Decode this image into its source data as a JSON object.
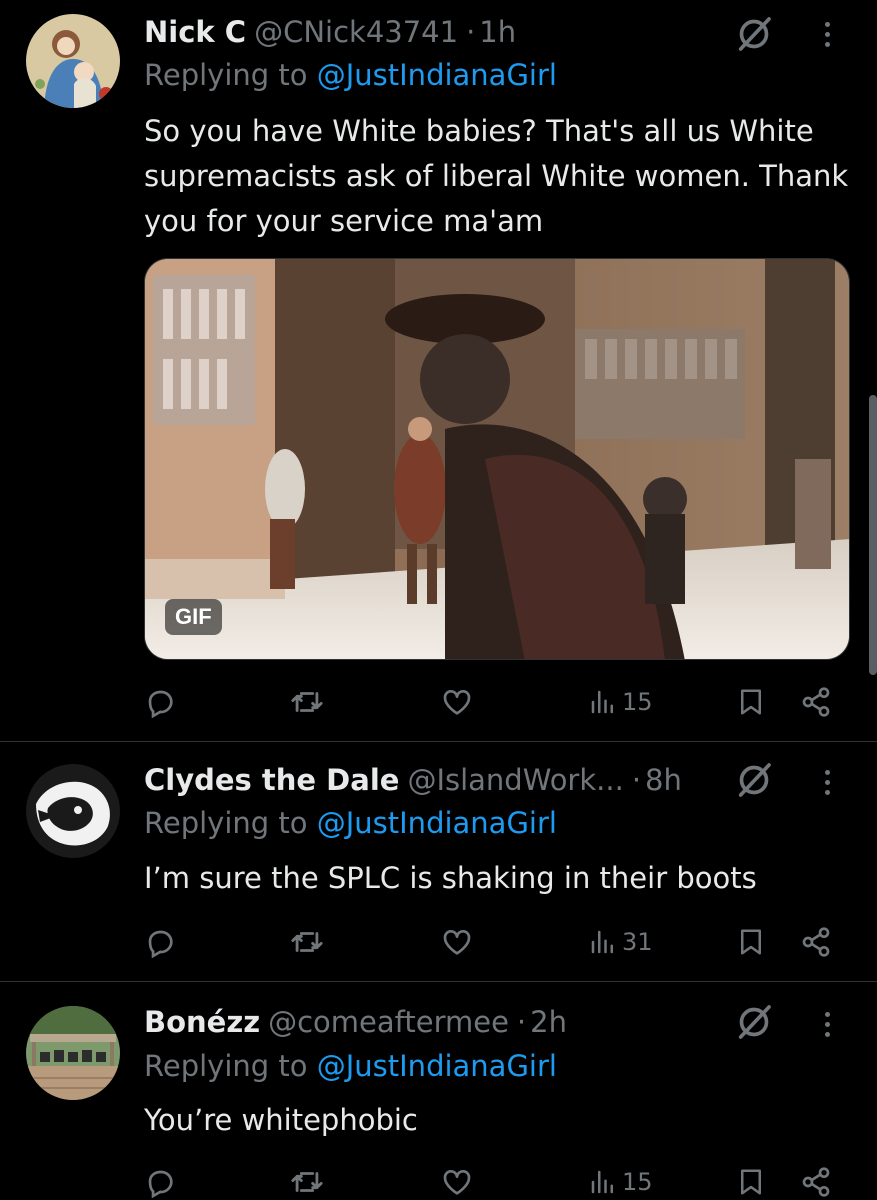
{
  "tweets": [
    {
      "name": "Nick C",
      "handle": "@CNick43741",
      "time": "1h",
      "replying_prefix": "Replying to ",
      "replying_to": "@JustIndianaGirl",
      "text": "So you have White babies? That's all us White supremacists ask of liberal White women. Thank you for your service ma'am",
      "media_badge": "GIF",
      "views": "15"
    },
    {
      "name": "Clydes the Dale",
      "handle": "@IslandWork...",
      "time": "8h",
      "replying_prefix": "Replying to ",
      "replying_to": "@JustIndianaGirl",
      "text": "I’m sure the SPLC is shaking in their boots",
      "views": "31"
    },
    {
      "name": "Bonézz",
      "handle": "@comeaftermee",
      "time": "2h",
      "replying_prefix": "Replying to ",
      "replying_to": "@JustIndianaGirl",
      "text": "You’re whitephobic",
      "views": "15"
    }
  ],
  "separator": "·",
  "icons": {
    "reply": "reply-icon",
    "retweet": "retweet-icon",
    "like": "heart-icon",
    "views": "views-icon",
    "bookmark": "bookmark-icon",
    "share": "share-icon",
    "grok": "grok-icon",
    "more": "more-icon"
  },
  "colors": {
    "background": "#000000",
    "text": "#e7e9ea",
    "secondary": "#71767b",
    "link": "#1d9bf0",
    "divider": "#2f3336"
  }
}
